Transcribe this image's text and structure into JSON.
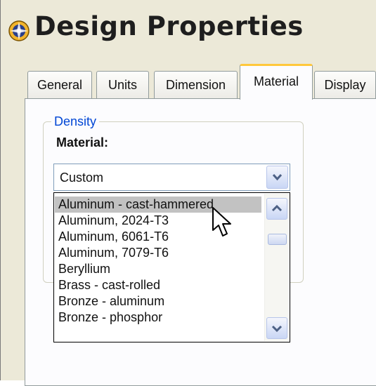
{
  "window": {
    "title": "Design Properties"
  },
  "tabs": [
    {
      "label": "General",
      "selected": false
    },
    {
      "label": "Units",
      "selected": false
    },
    {
      "label": "Dimension",
      "selected": false
    },
    {
      "label": "Material",
      "selected": true
    },
    {
      "label": "Display",
      "selected": false
    }
  ],
  "density_group": {
    "label": "Density",
    "material_label": "Material:",
    "material_value": "Custom"
  },
  "material_list": {
    "items": [
      "Aluminum - cast-hammered",
      "Aluminum, 2024-T3",
      "Aluminum, 6061-T6",
      "Aluminum, 7079-T6",
      "Beryllium",
      "Brass - cast-rolled",
      "Bronze - aluminum",
      "Bronze - phosphor"
    ],
    "highlighted_index": 0
  },
  "colors": {
    "group_label": "#0046d5",
    "selected_tab_accent": "#ffc83c",
    "highlight": "#c2c2c2"
  }
}
